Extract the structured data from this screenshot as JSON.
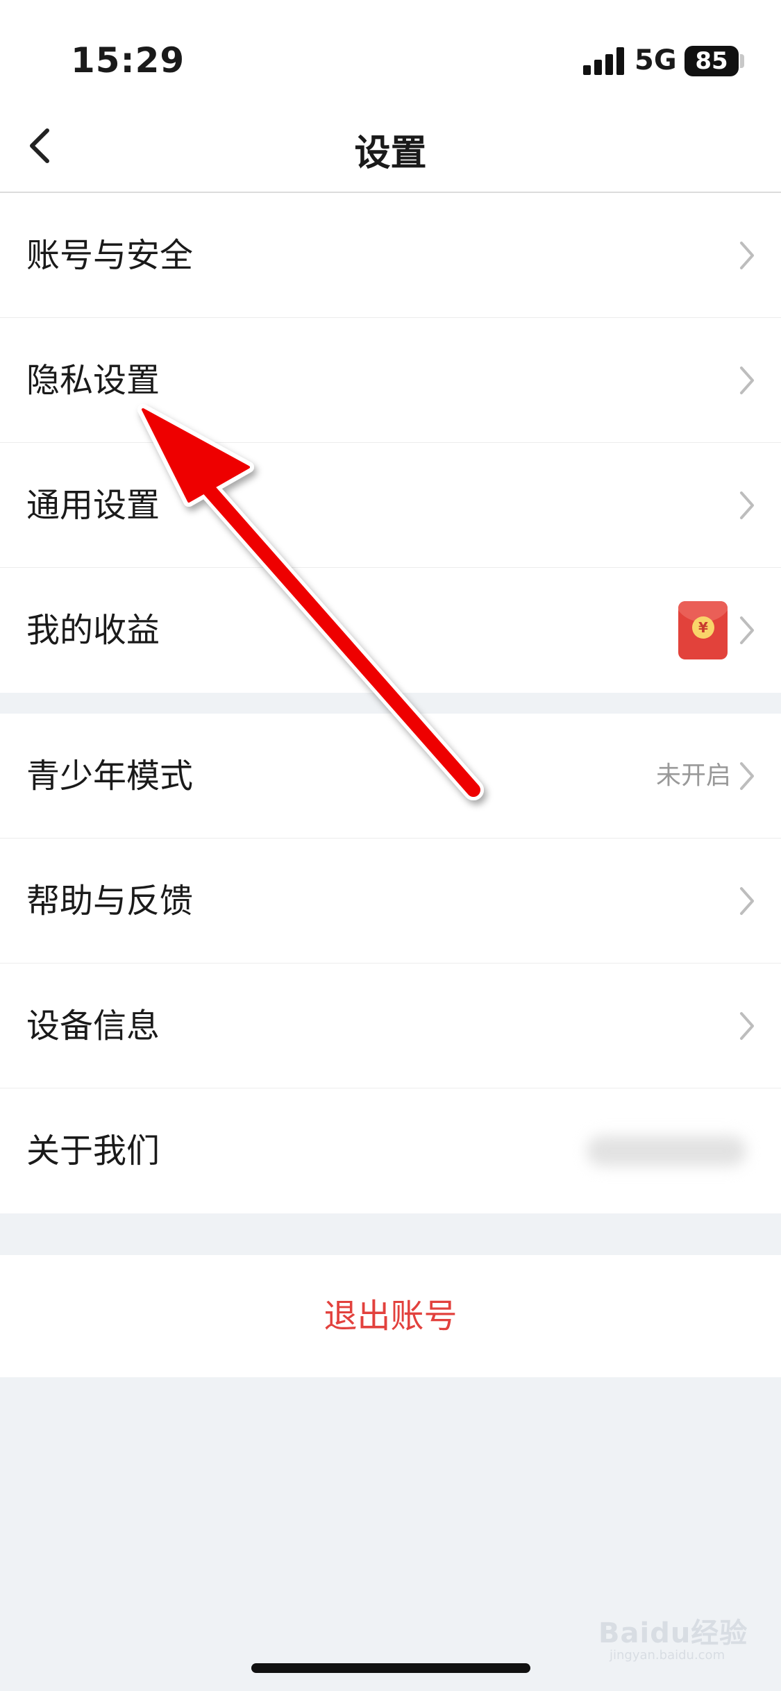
{
  "status_bar": {
    "time": "15:29",
    "network": "5G",
    "battery": "85"
  },
  "nav": {
    "title": "设置"
  },
  "group1": [
    {
      "label": "账号与安全"
    },
    {
      "label": "隐私设置"
    },
    {
      "label": "通用设置"
    },
    {
      "label": "我的收益",
      "badge_icon": "red-packet-icon",
      "badge_symbol": "¥"
    }
  ],
  "group2": [
    {
      "label": "青少年模式",
      "value": "未开启"
    },
    {
      "label": "帮助与反馈"
    },
    {
      "label": "设备信息"
    },
    {
      "label": "关于我们"
    }
  ],
  "logout": {
    "label": "退出账号"
  },
  "watermark": {
    "text": "Baidu经验",
    "sub": "jingyan.baidu.com"
  },
  "colors": {
    "accent_red": "#e2413d",
    "background": "#eff2f5",
    "annotation_arrow": "#ee0000"
  }
}
